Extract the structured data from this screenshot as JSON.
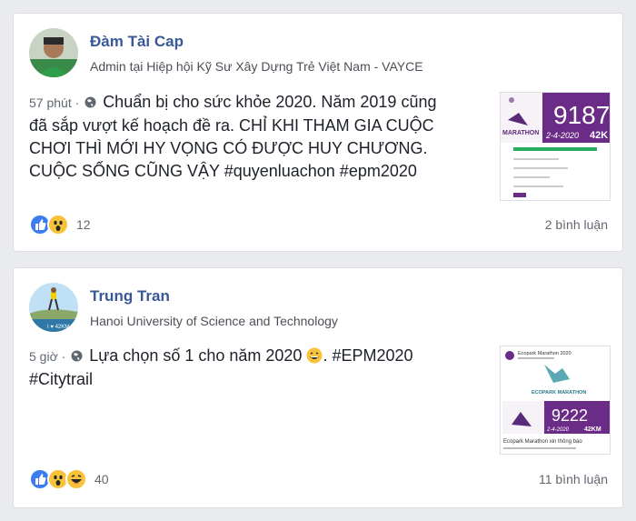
{
  "posts": [
    {
      "author": "Đàm Tài Cap",
      "subtitle": "Admin tại Hiệp hội Kỹ Sư Xây Dựng Trẻ Việt Nam - VAYCE",
      "time": "57 phút",
      "text_lines": [
        "Chuẩn bị cho sức khỏe 2020. Năm 2019 cũng",
        "đã sắp vượt kế hoạch đề ra. CHỈ KHI THAM GIA CUỘC",
        "CHƠI THÌ MỚI HY VỌNG CÓ ĐƯỢC HUY CHƯƠNG.",
        "CUỘC SỐNG CŨNG VẬY #quyenluachon #epm2020"
      ],
      "reactions": [
        "like-icon",
        "wow-icon"
      ],
      "reaction_count": "12",
      "comments": "2 bình luận",
      "thumb_number": "9187",
      "thumb_date": "2-4-2020",
      "thumb_distance": "42K"
    },
    {
      "author": "Trung Tran",
      "subtitle": "Hanoi University of Science and Technology",
      "time": "5 giờ",
      "text_line1": "Lựa chọn số 1 cho năm 2020",
      "text_line1_tail": ". #EPM2020",
      "text_line2": "#Citytrail",
      "reactions": [
        "like-icon",
        "wow-icon",
        "haha-icon"
      ],
      "reaction_count": "40",
      "comments": "11 bình luận",
      "thumb_header": "Ecopark Marathon 2020",
      "thumb_brand": "ECOPARK MARATHON",
      "thumb_number": "9222",
      "thumb_date": "2-4-2020",
      "thumb_distance": "42KM",
      "thumb_caption": "Ecopark Marathon xin thông báo"
    }
  ],
  "colors": {
    "link": "#385898",
    "accent_purple": "#6a2c86",
    "like_blue": "#3b7df0"
  }
}
